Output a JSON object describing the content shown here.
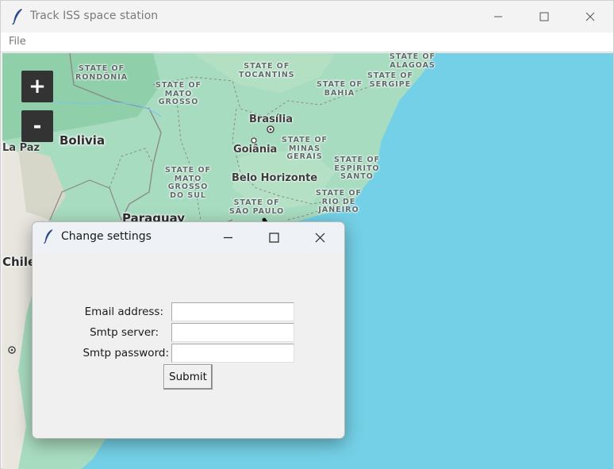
{
  "main_window": {
    "title": "Track ISS space station",
    "menu": [
      "File"
    ]
  },
  "map": {
    "zoom_in_label": "+",
    "zoom_out_label": "-",
    "state_labels": {
      "rondonia": "STATE OF\nRONDÔNIA",
      "mato_grosso": "STATE OF\nMATO\nGROSSO",
      "tocantins": "STATE OF\nTOCANTINS",
      "bahia": "STATE OF\nBAHIA",
      "sergipe": "STATE OF\nSERGIPE",
      "alagoas": "STATE OF\nALAGOAS",
      "minas_gerais": "STATE OF\nMINAS\nGERAIS",
      "espirito_santo": "STATE OF\nESPÍRITO\nSANTO",
      "mato_grosso_do_sul": "STATE OF\nMATO\nGROSSO\nDO SUL",
      "sao_paulo": "STATE OF\nSÃO PAULO",
      "rio_de_janeiro": "STATE OF\nRIO DE\nJANEIRO"
    },
    "city_labels": {
      "brasilia": "Brasília",
      "goiania": "Goiânia",
      "belo_horizonte": "Belo Horizonte",
      "la_paz": "La Paz"
    },
    "country_labels": {
      "bolivia": "Bolivia",
      "paraguay": "Paraguay",
      "chile": "Chile"
    },
    "colors": {
      "land": "#a8dcc0",
      "ocean": "#74d0e6"
    }
  },
  "dialog": {
    "title": "Change settings",
    "fields": [
      {
        "label": "Email address:",
        "value": ""
      },
      {
        "label": "Smtp server:",
        "value": ""
      },
      {
        "label": "Smtp password:",
        "value": ""
      }
    ],
    "submit_label": "Submit"
  }
}
